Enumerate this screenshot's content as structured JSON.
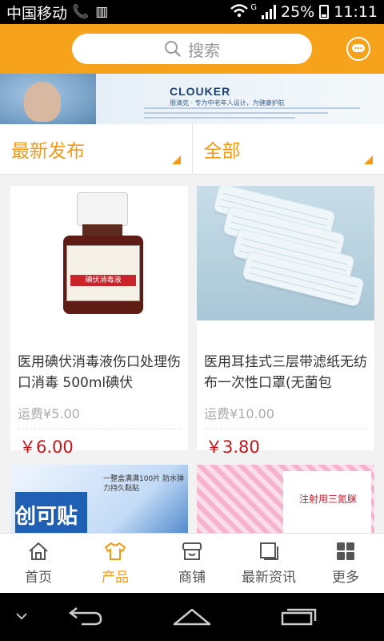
{
  "status_bar": {
    "carrier": "中国移动",
    "network": "G",
    "battery": "25%",
    "time": "11:11",
    "icons": [
      "phone-icon",
      "sim-icon",
      "wifi-icon",
      "signal-icon",
      "battery-icon"
    ]
  },
  "search": {
    "placeholder": "搜索",
    "icon": "search-icon"
  },
  "header": {
    "message_icon": "chat-icon",
    "accent_color": "#f7a21b"
  },
  "banner": {
    "brand": "CLOUKER",
    "slogan": "朋清克 · 专为中老年人设计，为健康护航"
  },
  "filters": [
    {
      "label": "最新发布"
    },
    {
      "label": "全部"
    }
  ],
  "products": [
    {
      "title": "医用碘伏消毒液伤口处理伤口消毒 500ml碘伏",
      "shipping": "运费¥5.00",
      "price": "￥6.00",
      "image_label": "碘伏消毒液"
    },
    {
      "title": "医用耳挂式三层带滤纸无纺布一次性口罩(无菌包",
      "shipping": "运费¥10.00",
      "price": "￥3.80"
    },
    {
      "image_caption": "一整盒满满100片 防水弹力持久黏贴",
      "image_logo": "创可贴"
    },
    {
      "image_title": "注射用三氮脒"
    }
  ],
  "bottom_nav": [
    {
      "label": "首页",
      "icon": "home-icon"
    },
    {
      "label": "产品",
      "icon": "shirt-icon"
    },
    {
      "label": "商铺",
      "icon": "store-icon"
    },
    {
      "label": "最新资讯",
      "icon": "news-icon"
    },
    {
      "label": "更多",
      "icon": "grid-icon"
    }
  ],
  "active_color": "#f39a14",
  "price_color": "#c7161c"
}
